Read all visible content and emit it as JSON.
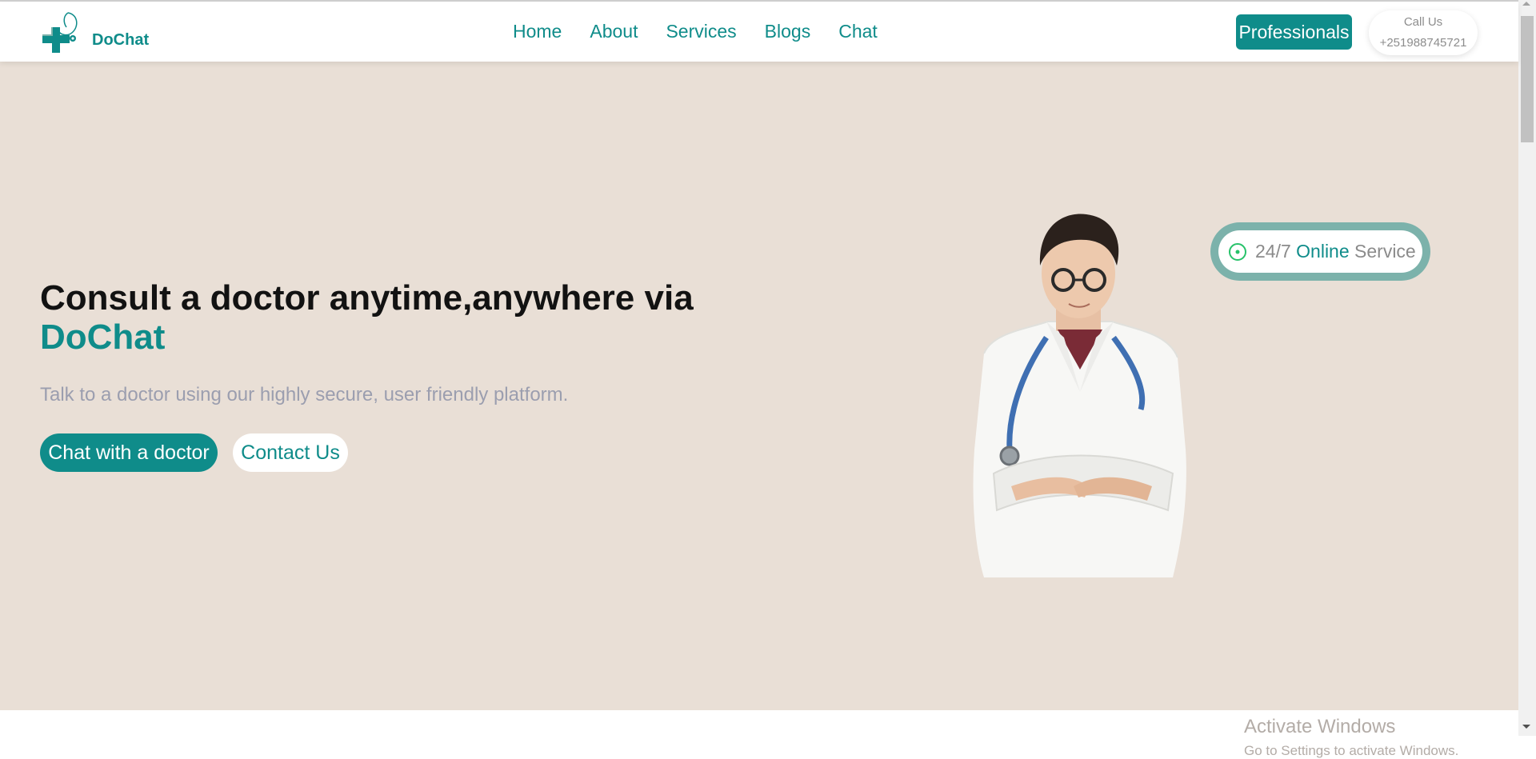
{
  "header": {
    "brand": "DoChat",
    "nav": [
      "Home",
      "About",
      "Services",
      "Blogs",
      "Chat"
    ],
    "professionals_label": "Professionals",
    "call_label": "Call Us",
    "call_number": "+251988745721"
  },
  "hero": {
    "headline": "Consult a doctor anytime,anywhere via",
    "headline_accent": "DoChat",
    "subtitle": "Talk to a doctor using our highly secure, user friendly platform.",
    "primary_cta": "Chat with a doctor",
    "secondary_cta": "Contact Us",
    "badge": {
      "part1": "24/7",
      "part2": "Online",
      "part3": "Service"
    }
  },
  "watermark": {
    "line1": "Activate Windows",
    "line2": "Go to Settings to activate Windows."
  },
  "colors": {
    "brand": "#0f8c8a",
    "hero_bg": "#e9dfd6",
    "badge_ring": "#7cb2ab",
    "text_muted": "#9b9eaf"
  },
  "icons": {
    "logo": "medical-cross-stethoscope-logo",
    "badge": "online-dot-icon"
  }
}
